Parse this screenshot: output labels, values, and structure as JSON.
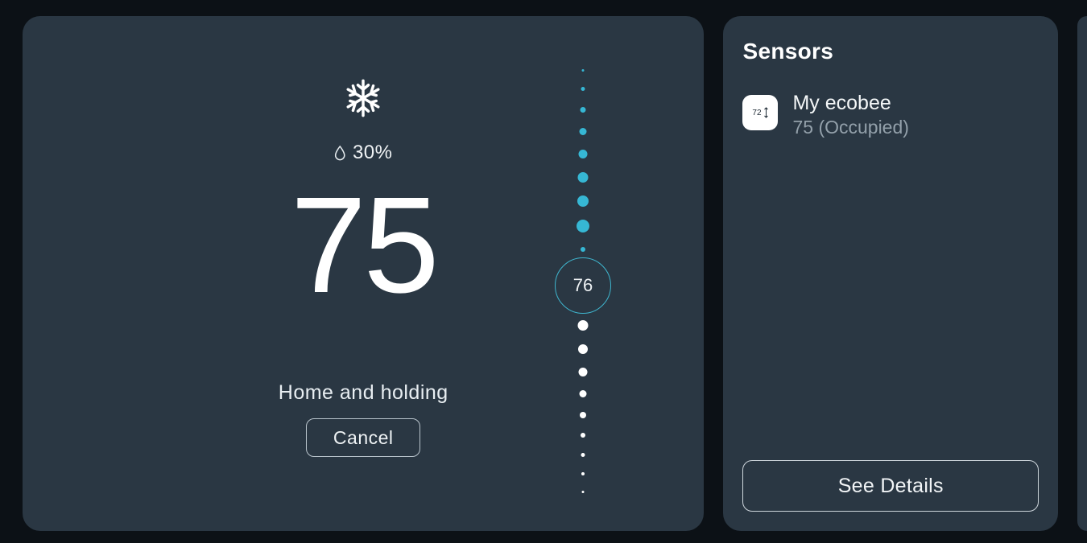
{
  "thermostat": {
    "mode_icon": "snowflake",
    "humidity_pct": "30%",
    "current_temp": "75",
    "setpoint": "76",
    "status": "Home and holding",
    "cancel_label": "Cancel",
    "slider": {
      "cool_color": "#36b7d4",
      "below_color": "#ffffff"
    }
  },
  "sensors": {
    "title": "Sensors",
    "items": [
      {
        "icon_temp": "72",
        "name": "My ecobee",
        "sub": "75 (Occupied)"
      }
    ],
    "details_label": "See Details"
  }
}
